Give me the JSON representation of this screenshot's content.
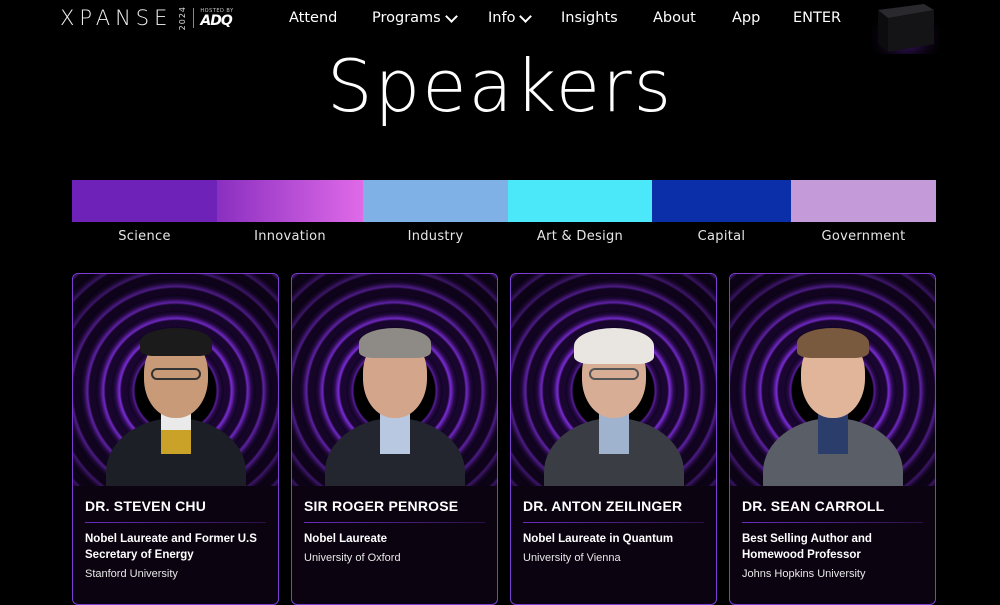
{
  "logo": {
    "word": "XPANSE",
    "year": "2024",
    "hosted_by": "HOSTED BY",
    "host": "ADQ"
  },
  "nav": [
    {
      "label": "Attend",
      "dropdown": false
    },
    {
      "label": "Programs",
      "dropdown": true
    },
    {
      "label": "Info",
      "dropdown": true
    },
    {
      "label": "Insights",
      "dropdown": false
    },
    {
      "label": "About",
      "dropdown": false
    },
    {
      "label": "App",
      "dropdown": false
    },
    {
      "label": "ENTER",
      "dropdown": false
    }
  ],
  "page": {
    "title": "Speakers"
  },
  "categories": [
    {
      "label": "Science",
      "color": "#6e22b8"
    },
    {
      "label": "Innovation",
      "color_from": "#8a2fc0",
      "color_to": "#e06ae8"
    },
    {
      "label": "Industry",
      "color": "#7fb0e6"
    },
    {
      "label": "Art & Design",
      "color": "#4ae8f8"
    },
    {
      "label": "Capital",
      "color": "#0a2fa8"
    },
    {
      "label": "Government",
      "color": "#c49ad8"
    }
  ],
  "speakers": [
    {
      "name": "DR. STEVEN CHU",
      "role": "Nobel Laureate and Former U.S Secretary of Energy",
      "org": "Stanford University"
    },
    {
      "name": "SIR ROGER PENROSE",
      "role": "Nobel Laureate",
      "org": "University of Oxford"
    },
    {
      "name": "DR. ANTON ZEILINGER",
      "role": "Nobel Laureate in Quantum",
      "org": "University of Vienna"
    },
    {
      "name": "DR. SEAN CARROLL",
      "role": "Best Selling Author and Homewood Professor",
      "org": "Johns Hopkins University"
    }
  ]
}
